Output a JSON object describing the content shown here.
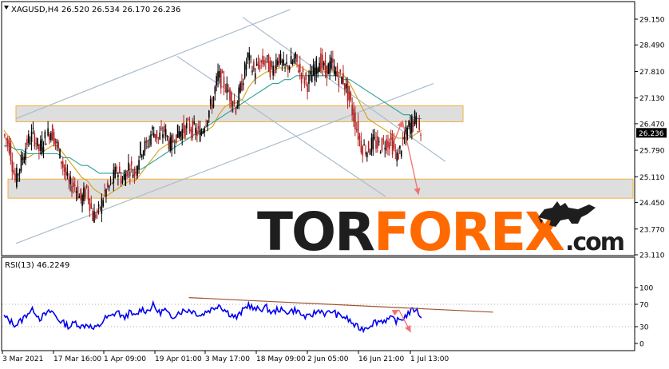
{
  "colors": {
    "background": "#ffffff",
    "frame": "#000000",
    "bull_candle": "#000000",
    "bear_candle": "#b22222",
    "ma_fast": "#d4a017",
    "ma_slow": "#2aa198",
    "channel_line": "#a9bccc",
    "zone_fill": "#d8d8d8",
    "zone_border": "#f0b040",
    "forecast_arrow": "#f07070",
    "rsi_line": "#0000ee",
    "rsi_trend": "#a0522d",
    "level_dot": "#aaaaaa",
    "logo_dark": "#1e1e1e",
    "logo_orange": "#ff6a00",
    "price_badge_bg": "#000000",
    "price_badge_text": "#ffffff"
  },
  "chart_data": [
    {
      "type": "candlestick",
      "title": "XAGUSD,H4  26.520 26.534 26.170 26.236",
      "symbol": "XAGUSD",
      "timeframe": "H4",
      "ohlc_header": {
        "open": 26.52,
        "high": 26.534,
        "low": 26.17,
        "close": 26.236
      },
      "current_price": 26.236,
      "ylim": [
        23.11,
        29.15
      ],
      "y_ticks": [
        29.15,
        28.49,
        27.81,
        27.13,
        26.47,
        25.79,
        25.11,
        24.45,
        23.77,
        23.11
      ],
      "y_tick_labels": [
        "29.150",
        "28.490",
        "27.810",
        "27.130",
        "26.470",
        "25.790",
        "25.110",
        "24.450",
        "23.770",
        "23.110"
      ],
      "x_labels": [
        "3 Mar 2021",
        "17 Mar 16:00",
        "1 Apr 09:00",
        "19 Apr 01:00",
        "3 May 17:00",
        "18 May 09:00",
        "2 Jun 05:00",
        "16 Jun 21:00",
        "1 Jul 13:00"
      ],
      "close_series": [
        26.2,
        25.9,
        25.0,
        25.5,
        26.0,
        26.2,
        25.8,
        26.1,
        26.3,
        25.9,
        25.4,
        24.9,
        24.9,
        24.5,
        24.8,
        24.1,
        24.2,
        24.7,
        24.9,
        25.3,
        25.0,
        25.4,
        25.2,
        25.8,
        25.9,
        26.3,
        26.1,
        26.3,
        25.9,
        26.2,
        26.3,
        26.4,
        26.3,
        26.2,
        26.6,
        27.0,
        27.7,
        27.5,
        27.2,
        26.9,
        27.5,
        28.2,
        27.8,
        28.0,
        28.1,
        27.8,
        28.2,
        27.9,
        28.0,
        28.1,
        27.7,
        27.5,
        27.8,
        28.1,
        27.8,
        28.0,
        27.7,
        27.6,
        27.1,
        26.5,
        25.9,
        25.8,
        26.0,
        25.9,
        26.0,
        26.0,
        25.6,
        26.0,
        26.4,
        26.6,
        26.2
      ],
      "moving_averages": [
        {
          "id": "ma-fast",
          "values": [
            26.3,
            26.1,
            25.8,
            25.6,
            25.6,
            25.7,
            25.7,
            25.8,
            25.9,
            25.9,
            25.7,
            25.5,
            25.3,
            25.1,
            25.0,
            24.8,
            24.7,
            24.6,
            24.7,
            24.8,
            24.9,
            25.0,
            25.0,
            25.2,
            25.4,
            25.6,
            25.8,
            25.9,
            26.0,
            26.0,
            26.1,
            26.1,
            26.2,
            26.2,
            26.3,
            26.4,
            26.7,
            26.9,
            27.0,
            27.0,
            27.1,
            27.4,
            27.6,
            27.7,
            27.8,
            27.8,
            27.9,
            27.9,
            27.9,
            28.0,
            27.9,
            27.8,
            27.8,
            27.8,
            27.8,
            27.8,
            27.8,
            27.7,
            27.5,
            27.2,
            26.9,
            26.6,
            26.5,
            26.4,
            26.3,
            26.2,
            26.1,
            26.1,
            26.1,
            26.2,
            26.3
          ]
        },
        {
          "id": "ma-slow",
          "values": [
            25.9,
            25.9,
            25.8,
            25.8,
            25.7,
            25.7,
            25.7,
            25.7,
            25.7,
            25.7,
            25.6,
            25.6,
            25.5,
            25.4,
            25.4,
            25.3,
            25.2,
            25.2,
            25.2,
            25.2,
            25.2,
            25.3,
            25.3,
            25.3,
            25.4,
            25.5,
            25.6,
            25.7,
            25.8,
            25.9,
            26.0,
            26.1,
            26.2,
            26.3,
            26.4,
            26.5,
            26.6,
            26.7,
            26.8,
            26.9,
            27.0,
            27.1,
            27.2,
            27.3,
            27.4,
            27.5,
            27.5,
            27.6,
            27.6,
            27.7,
            27.7,
            27.7,
            27.7,
            27.7,
            27.7,
            27.7,
            27.7,
            27.6,
            27.6,
            27.5,
            27.4,
            27.3,
            27.2,
            27.1,
            27.0,
            26.9,
            26.8,
            26.7,
            26.7,
            26.6,
            26.6
          ]
        }
      ],
      "zones": [
        {
          "id": "resistance-zone",
          "y_low": 26.52,
          "y_high": 26.93
        },
        {
          "id": "support-zone",
          "y_low": 24.56,
          "y_high": 25.05
        }
      ],
      "channel_lines": [
        {
          "id": "ascending-channel-lower",
          "from": [
            2.0,
            23.4
          ],
          "to": [
            72.0,
            27.5
          ]
        },
        {
          "id": "ascending-channel-upper",
          "from": [
            2.0,
            26.6
          ],
          "to": [
            48.0,
            29.4
          ]
        },
        {
          "id": "descending-channel-upper",
          "from": [
            40.0,
            29.2
          ],
          "to": [
            74.0,
            25.5
          ]
        },
        {
          "id": "descending-channel-lower",
          "from": [
            29.0,
            28.2
          ],
          "to": [
            64.0,
            24.6
          ]
        }
      ],
      "forecast_path": [
        [
          65.5,
          26.05
        ],
        [
          66.8,
          26.55
        ],
        [
          69.5,
          24.65
        ]
      ]
    },
    {
      "type": "line",
      "title": "RSI(13) 46.2249",
      "indicator": "RSI(13)",
      "current_value": 46.2249,
      "ylim": [
        0,
        100
      ],
      "y_ticks": [
        100,
        70,
        30,
        0
      ],
      "y_tick_labels": [
        "100",
        "70",
        "30",
        "0"
      ],
      "levels": [
        70,
        30
      ],
      "values": [
        48,
        40,
        33,
        42,
        55,
        60,
        45,
        52,
        58,
        44,
        36,
        30,
        38,
        30,
        35,
        25,
        32,
        45,
        48,
        58,
        45,
        55,
        48,
        62,
        58,
        68,
        55,
        60,
        45,
        55,
        58,
        60,
        56,
        50,
        58,
        62,
        70,
        60,
        52,
        46,
        58,
        70,
        60,
        62,
        64,
        54,
        62,
        56,
        58,
        60,
        50,
        46,
        54,
        60,
        52,
        58,
        50,
        48,
        40,
        30,
        26,
        30,
        38,
        40,
        42,
        44,
        40,
        46,
        56,
        62,
        46
      ],
      "trendline": {
        "from": [
          31.0,
          82.0
        ],
        "to": [
          82.0,
          56.0
        ]
      },
      "forecast_path": [
        [
          65.3,
          55.0
        ],
        [
          66.2,
          60.0
        ],
        [
          68.2,
          20.0
        ]
      ]
    }
  ],
  "watermark": {
    "part_dark_1": "TOR",
    "part_orange": "FOREX",
    "part_dark_2": ".com"
  }
}
